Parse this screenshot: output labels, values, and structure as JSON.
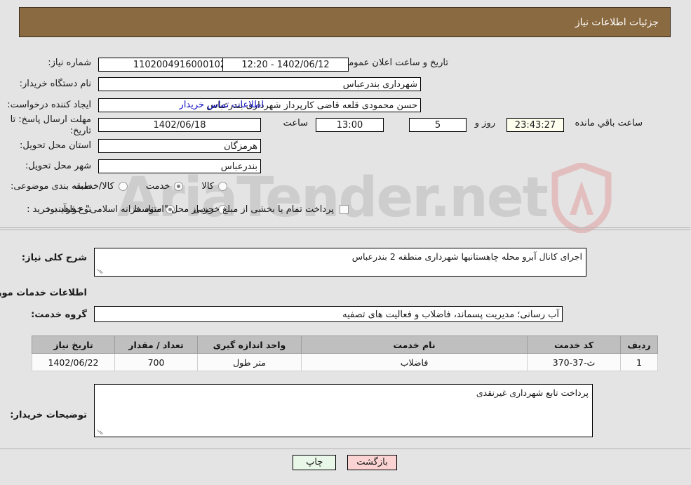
{
  "header": {
    "title": "جزئیات اطلاعات نیاز"
  },
  "watermark": {
    "text_a": "Aria",
    "text_b": "Tender",
    "text_c": ".net"
  },
  "fields": {
    "need_number_label": "شماره نیاز:",
    "need_number_value": "1102004916000102",
    "announce_datetime_label": "تاریخ و ساعت اعلان عمومی:",
    "announce_datetime_value": "12:20 - 1402/06/12",
    "buyer_org_label": "نام دستگاه خریدار:",
    "buyer_org_value": "شهرداری بندرعباس",
    "requester_label": "ایجاد کننده درخواست:",
    "requester_value": "حسن محمودی قلعه قاضی کارپرداز شهرداری بندرعباس",
    "contact_link": "اطلاعات تماس خریدار",
    "deadline_label": "مهلت ارسال پاسخ: تا تاریخ:",
    "deadline_date": "1402/06/18",
    "deadline_hour_label": "ساعت",
    "deadline_hour_value": "13:00",
    "remaining_days_value": "5",
    "remaining_days_label": "روز و",
    "remaining_time_value": "23:43:27",
    "remaining_time_label": "ساعت باقي مانده",
    "province_label": "استان محل تحویل:",
    "province_value": "هرمزگان",
    "city_label": "شهر محل تحویل:",
    "city_value": "بندرعباس",
    "category_label": "طبقه بندی موضوعی:",
    "process_type_label": "نوع فرآیند خرید :"
  },
  "category_options": [
    {
      "label": "کالا",
      "selected": false
    },
    {
      "label": "خدمت",
      "selected": true
    },
    {
      "label": "کالا/خدمت",
      "selected": false
    }
  ],
  "process_options": [
    {
      "label": "جزیی",
      "selected": false
    },
    {
      "label": "متوسط",
      "selected": true
    }
  ],
  "treasury": {
    "checked": false,
    "label": "پرداخت تمام یا بخشی از مبلغ خرید،از محل \"اسناد خزانه اسلامی\" خواهد بود."
  },
  "general_desc": {
    "label": "شرح کلی نیاز:",
    "value": "اجرای کانال آبرو محله چاهستانیها شهرداری منطقه 2 بندرعباس"
  },
  "services_section": {
    "title": "اطلاعات خدمات مورد نیاز",
    "group_label": "گروه خدمت:",
    "group_value": "آب رسانی؛ مدیریت پسماند، فاضلاب و فعالیت های تصفیه"
  },
  "table": {
    "headers": [
      "ردیف",
      "کد خدمت",
      "نام خدمت",
      "واحد اندازه گیری",
      "تعداد / مقدار",
      "تاریخ نیاز"
    ],
    "rows": [
      {
        "index": "1",
        "code": "ث-37-370",
        "name": "فاضلاب",
        "unit": "متر طول",
        "quantity": "700",
        "date": "1402/06/22"
      }
    ]
  },
  "buyer_notes": {
    "label": "توضیحات خریدار:",
    "value": "پرداخت تابع شهرداری غیرنقدی"
  },
  "buttons": {
    "print": "چاپ",
    "back": "بازگشت"
  },
  "colors": {
    "header_bg": "#8a6a41",
    "page_bg": "#e4e4e4",
    "link": "#1515c7",
    "print_bg": "#e8f7e8",
    "back_bg": "#fbd3d3"
  }
}
